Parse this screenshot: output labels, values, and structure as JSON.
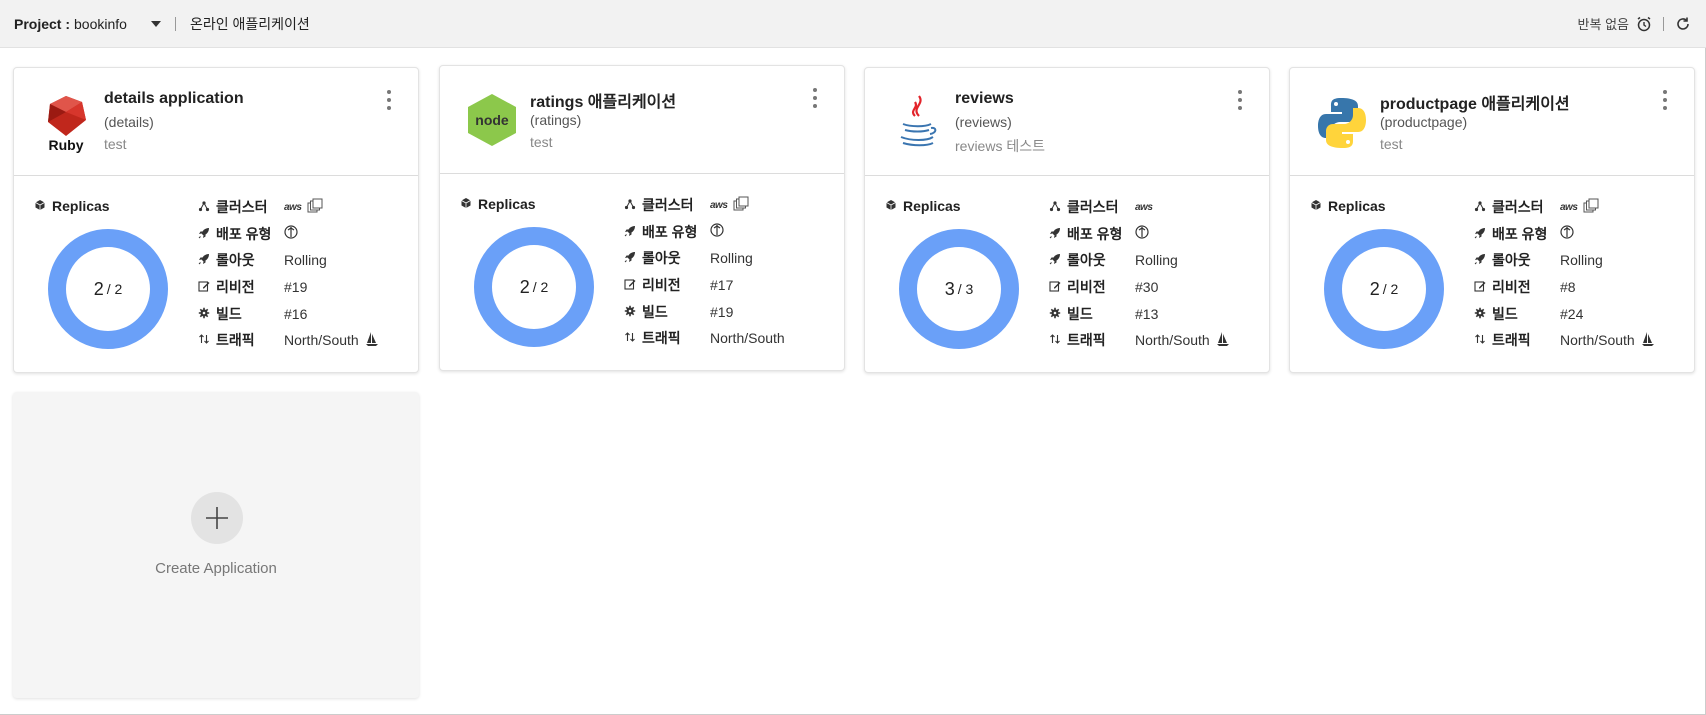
{
  "topbar": {
    "project_label": "Project :",
    "project_value": "bookinfo",
    "breadcrumb": "온라인 애플리케이션",
    "repeat_text": "반복 없음"
  },
  "labels": {
    "replicas": "Replicas",
    "cluster": "클러스터",
    "deploy_type": "배포 유형",
    "rollout": "롤아웃",
    "revision": "리비전",
    "build": "빌드",
    "traffic": "트래픽",
    "aws": "aws"
  },
  "cards": [
    {
      "title": "details application",
      "subtitle": "(details)",
      "description": "test",
      "logo": "ruby-logo",
      "logo_text": "Ruby",
      "replicas_ready": "2",
      "replicas_total": "/ 2",
      "rollout": "Rolling",
      "revision": "#19",
      "build": "#16",
      "traffic": "North/South",
      "multi_cluster": true,
      "traffic_icon": true
    },
    {
      "title": "ratings 애플리케이션",
      "subtitle": "(ratings)",
      "description": "test",
      "logo": "nodejs-logo",
      "logo_text": "node",
      "replicas_ready": "2",
      "replicas_total": "/ 2",
      "rollout": "Rolling",
      "revision": "#17",
      "build": "#19",
      "traffic": "North/South",
      "multi_cluster": true,
      "traffic_icon": false
    },
    {
      "title": "reviews",
      "subtitle": "(reviews)",
      "description": "reviews 테스트",
      "logo": "java-logo",
      "logo_text": "",
      "replicas_ready": "3",
      "replicas_total": "/ 3",
      "rollout": "Rolling",
      "revision": "#30",
      "build": "#13",
      "traffic": "North/South",
      "multi_cluster": false,
      "traffic_icon": true
    },
    {
      "title": "productpage 애플리케이션",
      "subtitle": "(productpage)",
      "description": "test",
      "logo": "python-logo",
      "logo_text": "",
      "replicas_ready": "2",
      "replicas_total": "/ 2",
      "rollout": "Rolling",
      "revision": "#8",
      "build": "#24",
      "traffic": "North/South",
      "multi_cluster": true,
      "traffic_icon": true
    }
  ],
  "create": {
    "label": "Create Application"
  },
  "colors": {
    "donut": "#6aa0f8",
    "ruby": "#c0271c",
    "node": "#8cc84b",
    "python_blue": "#3776ab",
    "python_yellow": "#ffd43b",
    "java_red": "#e3242b",
    "java_blue": "#3a75b0"
  }
}
